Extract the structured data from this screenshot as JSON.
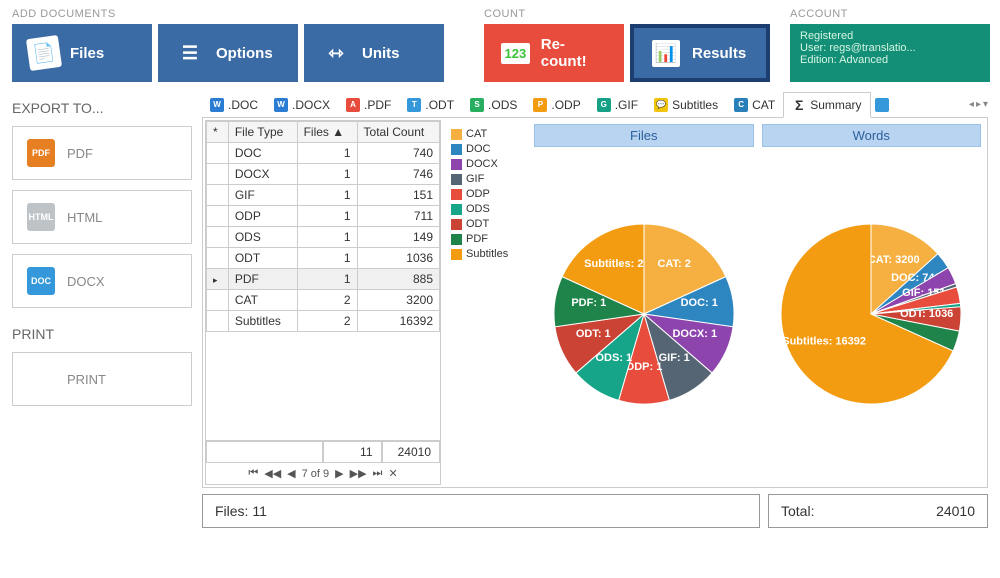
{
  "sections": {
    "add_docs": "ADD DOCUMENTS",
    "count": "COUNT",
    "account": "ACCOUNT"
  },
  "toolbar": {
    "files": "Files",
    "options": "Options",
    "units": "Units",
    "recount": "Re-count!",
    "results": "Results"
  },
  "account": {
    "status": "Registered",
    "user": "User: regs@translatio...",
    "edition": "Edition: Advanced"
  },
  "export": {
    "label": "EXPORT TO...",
    "pdf": "PDF",
    "html": "HTML",
    "docx": "DOCX"
  },
  "print": {
    "label": "PRINT",
    "btn": "PRINT"
  },
  "tabs": {
    "doc": ".DOC",
    "docx": ".DOCX",
    "pdf": ".PDF",
    "odt": ".ODT",
    "ods": ".ODS",
    "odp": ".ODP",
    "gif": ".GIF",
    "subtitles": "Subtitles",
    "cat": "CAT",
    "summary": "Summary"
  },
  "table": {
    "headers": {
      "star": "*",
      "filetype": "File Type",
      "files": "Files",
      "sort": "▲",
      "total": "Total Count"
    },
    "rows": [
      {
        "type": "DOC",
        "files": 1,
        "total": 740
      },
      {
        "type": "DOCX",
        "files": 1,
        "total": 746
      },
      {
        "type": "GIF",
        "files": 1,
        "total": 151
      },
      {
        "type": "ODP",
        "files": 1,
        "total": 711
      },
      {
        "type": "ODS",
        "files": 1,
        "total": 149
      },
      {
        "type": "ODT",
        "files": 1,
        "total": 1036
      },
      {
        "type": "PDF",
        "files": 1,
        "total": 885
      },
      {
        "type": "CAT",
        "files": 2,
        "total": 3200
      },
      {
        "type": "Subtitles",
        "files": 2,
        "total": 16392
      }
    ],
    "sum_files": 11,
    "sum_total": 24010,
    "pager": "7 of 9"
  },
  "legend": [
    "CAT",
    "DOC",
    "DOCX",
    "GIF",
    "ODP",
    "ODS",
    "ODT",
    "PDF",
    "Subtitles"
  ],
  "legend_colors": {
    "CAT": "#f5b041",
    "DOC": "#2e86c1",
    "DOCX": "#8e44ad",
    "GIF": "#566573",
    "ODP": "#e74c3c",
    "ODS": "#17a589",
    "ODT": "#cb4335",
    "PDF": "#1e8449",
    "Subtitles": "#f39c12"
  },
  "chart_data": [
    {
      "type": "pie",
      "title": "Files",
      "series": [
        {
          "name": "CAT",
          "value": 2
        },
        {
          "name": "DOC",
          "value": 1
        },
        {
          "name": "DOCX",
          "value": 1
        },
        {
          "name": "GIF",
          "value": 1
        },
        {
          "name": "ODP",
          "value": 1
        },
        {
          "name": "ODS",
          "value": 1
        },
        {
          "name": "ODT",
          "value": 1
        },
        {
          "name": "PDF",
          "value": 1
        },
        {
          "name": "Subtitles",
          "value": 2
        }
      ]
    },
    {
      "type": "pie",
      "title": "Words",
      "series": [
        {
          "name": "CAT",
          "value": 3200
        },
        {
          "name": "DOC",
          "value": 740
        },
        {
          "name": "DOCX",
          "value": 746
        },
        {
          "name": "GIF",
          "value": 151
        },
        {
          "name": "ODP",
          "value": 711
        },
        {
          "name": "ODS",
          "value": 149
        },
        {
          "name": "ODT",
          "value": 1036
        },
        {
          "name": "PDF",
          "value": 885
        },
        {
          "name": "Subtitles",
          "value": 16392
        }
      ]
    }
  ],
  "footer": {
    "files_label": "Files:",
    "files_val": "11",
    "total_label": "Total:",
    "total_val": "24010"
  }
}
